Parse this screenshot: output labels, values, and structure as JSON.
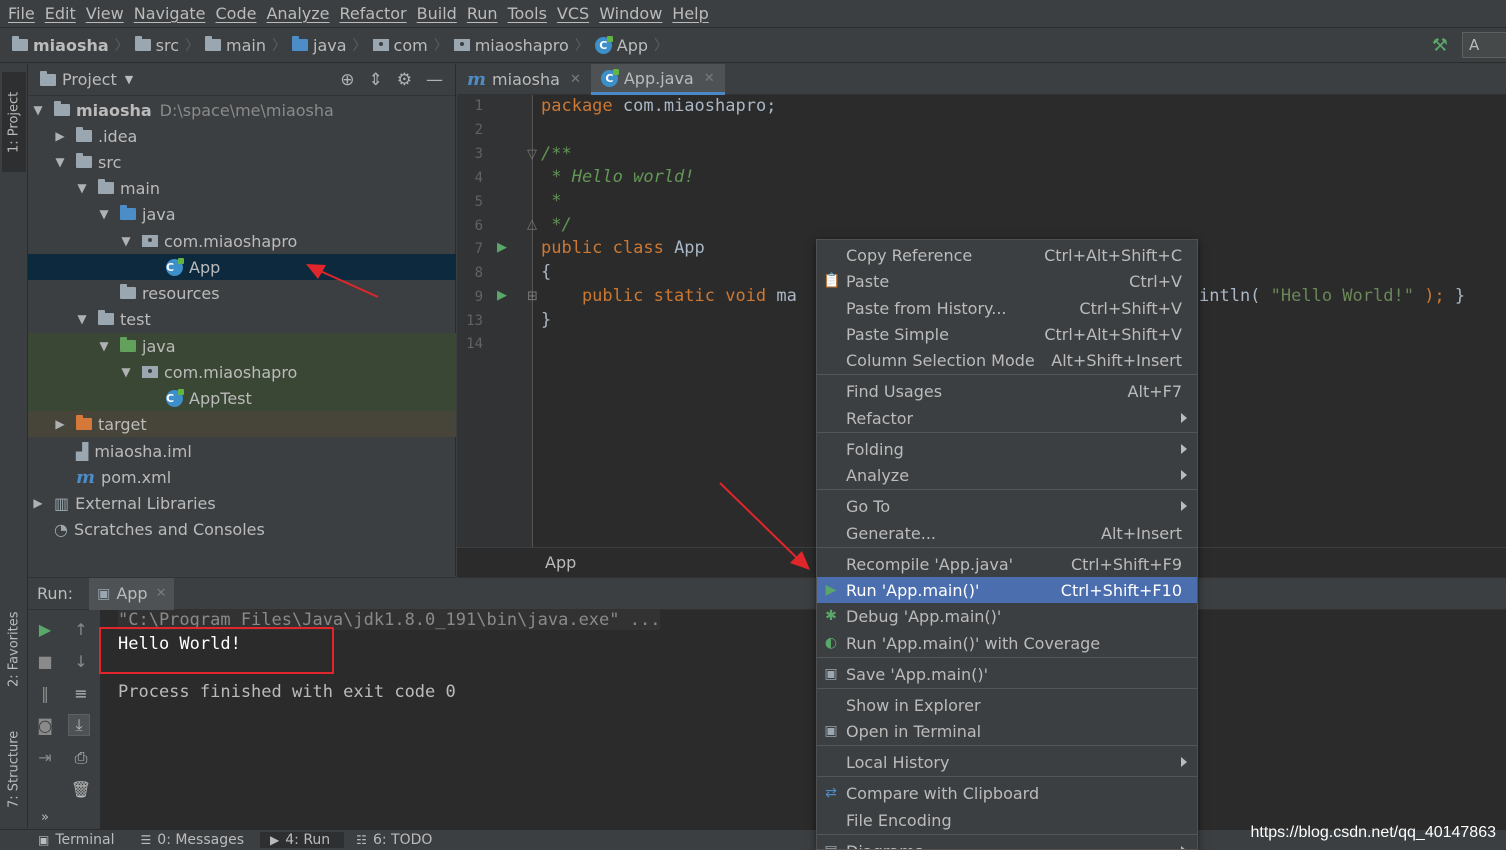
{
  "menu": [
    "File",
    "Edit",
    "View",
    "Navigate",
    "Code",
    "Analyze",
    "Refactor",
    "Build",
    "Run",
    "Tools",
    "VCS",
    "Window",
    "Help"
  ],
  "breadcrumb": [
    "miaosha",
    "src",
    "main",
    "java",
    "com",
    "miaoshapro",
    "App"
  ],
  "run_config_label": "A",
  "side_tabs": {
    "project": "1: Project",
    "favorites": "2: Favorites",
    "structure": "7: Structure"
  },
  "project": {
    "title": "Project",
    "root_name": "miaosha",
    "root_path": "D:\\space\\me\\miaosha",
    "items": [
      ".idea",
      "src",
      "main",
      "java",
      "com.miaoshapro",
      "App",
      "resources",
      "test",
      "java",
      "com.miaoshapro",
      "AppTest",
      "target",
      "miaosha.iml",
      "pom.xml",
      "External Libraries",
      "Scratches and Consoles"
    ]
  },
  "editor": {
    "tabs": [
      "miaosha",
      "App.java"
    ],
    "line_numbers": [
      "1",
      "2",
      "3",
      "4",
      "5",
      "6",
      "7",
      "8",
      "9",
      "13",
      "14"
    ],
    "lines": {
      "l1_kw": "package",
      "l1_rest": " com.miaoshapro;",
      "l3": "/**",
      "l4": " * Hello world!",
      "l5": " *",
      "l6": " */",
      "l7_kw": "public class",
      "l7_rest": " App",
      "l8": "{",
      "l9_kw": "    public static void",
      "l9_rest": " ma",
      "l9_tail_a": "intln( ",
      "l9_tail_str": "\"Hello World!\"",
      "l9_tail_b": " );",
      "l9_tail_c": " }",
      "l13": "}"
    },
    "status": "App"
  },
  "run": {
    "label": "Run:",
    "tab": "App",
    "console": [
      "\"C:\\Program Files\\Java\\jdk1.8.0_191\\bin\\java.exe\" ...",
      "Hello World!",
      "",
      "Process finished with exit code 0"
    ]
  },
  "bottom_tabs": [
    "Terminal",
    "0: Messages",
    "4: Run",
    "6: TODO"
  ],
  "context_menu": {
    "items": [
      {
        "label": "Copy Reference",
        "shortcut": "Ctrl+Alt+Shift+C"
      },
      {
        "label": "Paste",
        "shortcut": "Ctrl+V"
      },
      {
        "label": "Paste from History...",
        "shortcut": "Ctrl+Shift+V"
      },
      {
        "label": "Paste Simple",
        "shortcut": "Ctrl+Alt+Shift+V"
      },
      {
        "label": "Column Selection Mode",
        "shortcut": "Alt+Shift+Insert"
      },
      {
        "label": "Find Usages",
        "shortcut": "Alt+F7"
      },
      {
        "label": "Refactor",
        "shortcut": ""
      },
      {
        "label": "Folding",
        "shortcut": ""
      },
      {
        "label": "Analyze",
        "shortcut": ""
      },
      {
        "label": "Go To",
        "shortcut": ""
      },
      {
        "label": "Generate...",
        "shortcut": "Alt+Insert"
      },
      {
        "label": "Recompile 'App.java'",
        "shortcut": "Ctrl+Shift+F9"
      },
      {
        "label": "Run 'App.main()'",
        "shortcut": "Ctrl+Shift+F10"
      },
      {
        "label": "Debug 'App.main()'",
        "shortcut": ""
      },
      {
        "label": "Run 'App.main()' with Coverage",
        "shortcut": ""
      },
      {
        "label": "Save 'App.main()'",
        "shortcut": ""
      },
      {
        "label": "Show in Explorer",
        "shortcut": ""
      },
      {
        "label": "Open in Terminal",
        "shortcut": ""
      },
      {
        "label": "Local History",
        "shortcut": ""
      },
      {
        "label": "Compare with Clipboard",
        "shortcut": ""
      },
      {
        "label": "File Encoding",
        "shortcut": ""
      },
      {
        "label": "Diagrams",
        "shortcut": ""
      }
    ]
  },
  "watermark": "https://blog.csdn.net/qq_40147863",
  "colors": {
    "accent": "#4b6eaf",
    "selection": "#0d293e",
    "annotation": "#e0262a",
    "keyword": "#cc7832",
    "comment": "#629755"
  }
}
